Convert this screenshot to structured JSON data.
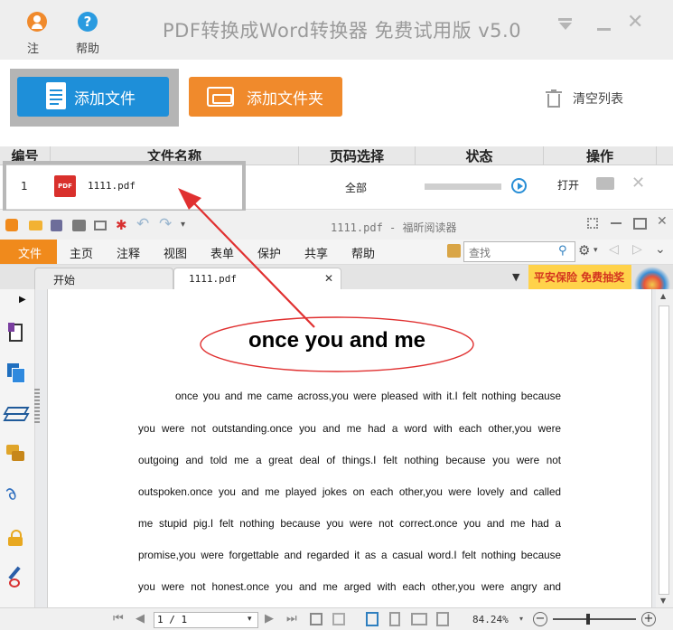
{
  "app": {
    "title": "PDF转换成Word转换器 免费试用版 v5.0",
    "register_label": "注册",
    "help_label": "帮助"
  },
  "toolbar": {
    "add_file_label": "添加文件",
    "add_folder_label": "添加文件夹",
    "clear_list_label": "清空列表"
  },
  "table": {
    "headers": [
      "编号",
      "文件名称",
      "页码选择",
      "状态",
      "操作"
    ],
    "rows": [
      {
        "index": "1",
        "filename": "1111.pdf",
        "pages": "全部",
        "status_progress": 0,
        "open_label": "打开"
      }
    ]
  },
  "reader": {
    "window_title": "1111.pdf - 福昕阅读器",
    "menu": [
      "文件",
      "主页",
      "注释",
      "视图",
      "表单",
      "保护",
      "共享",
      "帮助"
    ],
    "search_placeholder": "查找",
    "tabs": [
      "开始",
      "1111.pdf"
    ],
    "ad_text": "平安保险 免费抽奖",
    "document": {
      "title": "once you and me",
      "lines": [
        "once you and me came across,you were pleased with it.I felt nothing because",
        "you were not outstanding.once you and me had a word with each other,you were",
        "outgoing and told me a great deal of things.I felt nothing because you were not",
        "outspoken.once you and me played jokes on each other,you were lovely and called",
        "me stupid pig.I felt nothing because you were not correct.once you and me had a",
        "promise,you were forgettable and regarded it as a casual word.I felt nothing because",
        "you were not honest.once you and me arged with each other,you were angry and"
      ]
    },
    "status": {
      "page_field": "1 / 1",
      "zoom": "84.24%",
      "zoom_level": 0.84
    }
  },
  "colors": {
    "add_file_bg": "#1e8fd9",
    "add_folder_bg": "#f08a2c",
    "menu_file_bg": "#f08a1c",
    "annotation_red": "#e03030",
    "ad_bg": "#ffd24a"
  }
}
